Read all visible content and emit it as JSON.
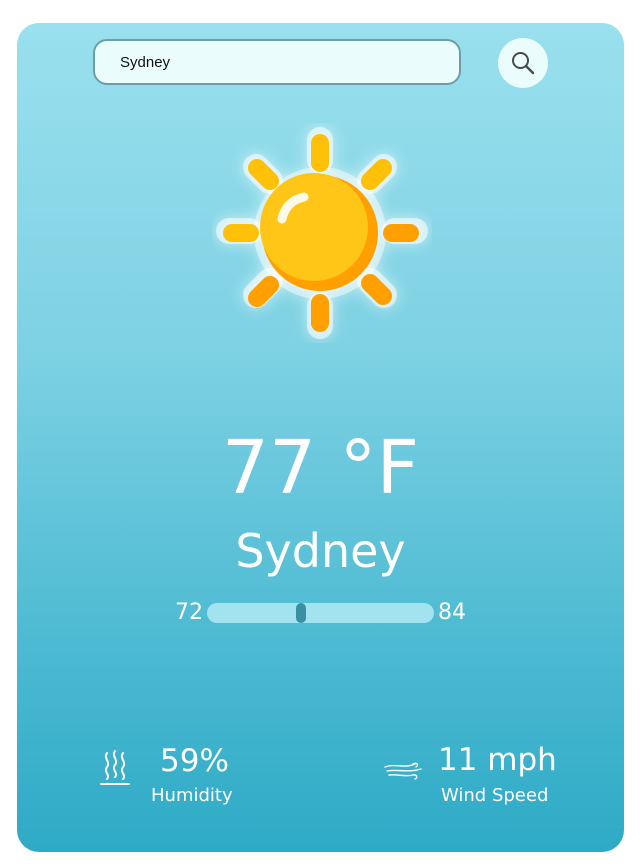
{
  "search": {
    "value": "Sydney",
    "placeholder": ""
  },
  "weather": {
    "icon": "sun-icon",
    "temperature": "77 °F",
    "city": "Sydney",
    "range": {
      "min": "72",
      "max": "84",
      "current_fraction": 0.41
    }
  },
  "stats": {
    "humidity": {
      "icon": "humidity-icon",
      "value": "59%",
      "label": "Humidity"
    },
    "wind": {
      "icon": "wind-icon",
      "value": "11 mph",
      "label": "Wind Speed"
    }
  },
  "colors": {
    "card_top": "#9ae0ee",
    "card_bottom": "#2eaac6",
    "input_bg": "#eafdfc",
    "sun": "#ffc107",
    "sun_shade": "#ffa000",
    "range_track": "#a3e3ef",
    "range_thumb": "#3a8fa1",
    "text": "#ffffff"
  }
}
